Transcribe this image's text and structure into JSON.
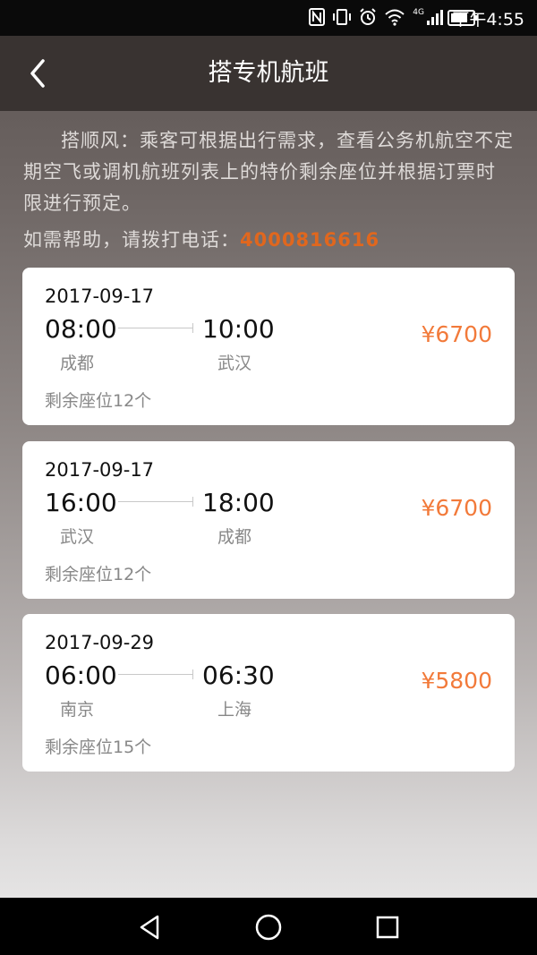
{
  "status_bar": {
    "time": "下午4:55",
    "network": "4G",
    "icons": [
      "nfc-icon",
      "vibrate-icon",
      "alarm-icon",
      "wifi-icon",
      "signal-icon",
      "battery-icon"
    ]
  },
  "nav": {
    "title": "搭专机航班",
    "back_icon": "chevron-left-icon"
  },
  "intro": {
    "text": "搭顺风：乘客可根据出行需求，查看公务机航空不定期空飞或调机航班列表上的特价剩余座位并根据订票时限进行预定。",
    "help_label": "如需帮助，请拨打电话：",
    "phone": "4000816616"
  },
  "flights": [
    {
      "date": "2017-09-17",
      "dep_time": "08:00",
      "arr_time": "10:00",
      "dep_city": "成都",
      "arr_city": "武汉",
      "seats": "剩余座位12个",
      "price": "¥6700"
    },
    {
      "date": "2017-09-17",
      "dep_time": "16:00",
      "arr_time": "18:00",
      "dep_city": "武汉",
      "arr_city": "成都",
      "seats": "剩余座位12个",
      "price": "¥6700"
    },
    {
      "date": "2017-09-29",
      "dep_time": "06:00",
      "arr_time": "06:30",
      "dep_city": "南京",
      "arr_city": "上海",
      "seats": "剩余座位15个",
      "price": "¥5800"
    }
  ],
  "system_nav": [
    "back-triangle-icon",
    "home-circle-icon",
    "recents-square-icon"
  ],
  "colors": {
    "accent": "#f27a3a",
    "phone": "#e0671e",
    "nav_bg": "#393331"
  }
}
